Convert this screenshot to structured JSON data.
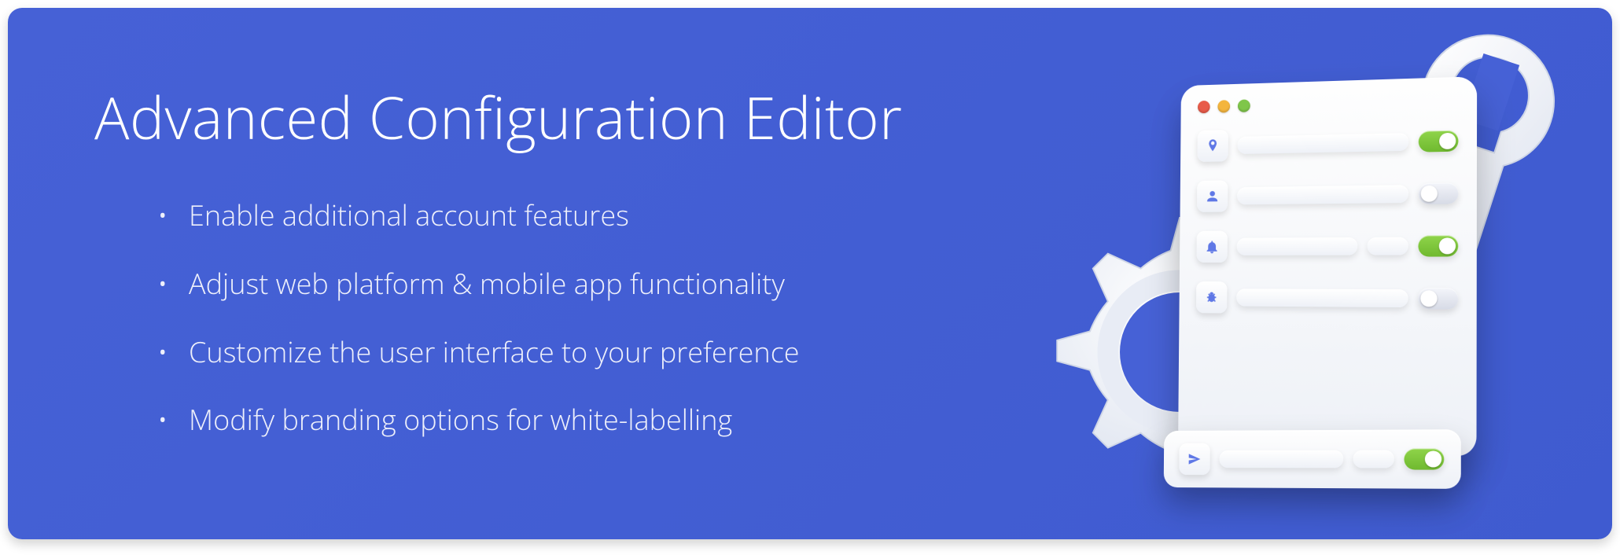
{
  "title": "Advanced Configuration Editor",
  "bullets": [
    "Enable additional account features",
    "Adjust web platform & mobile app functionality",
    "Customize the user interface to your preference",
    "Modify branding options for white-labelling"
  ],
  "illustration": {
    "rows": [
      {
        "icon": "map-pin-icon",
        "toggle": "on"
      },
      {
        "icon": "user-icon",
        "toggle": "off"
      },
      {
        "icon": "bell-icon",
        "toggle": "on"
      },
      {
        "icon": "bug-icon",
        "toggle": "off"
      }
    ],
    "floating": {
      "icon": "send-icon",
      "toggle": "on"
    }
  }
}
